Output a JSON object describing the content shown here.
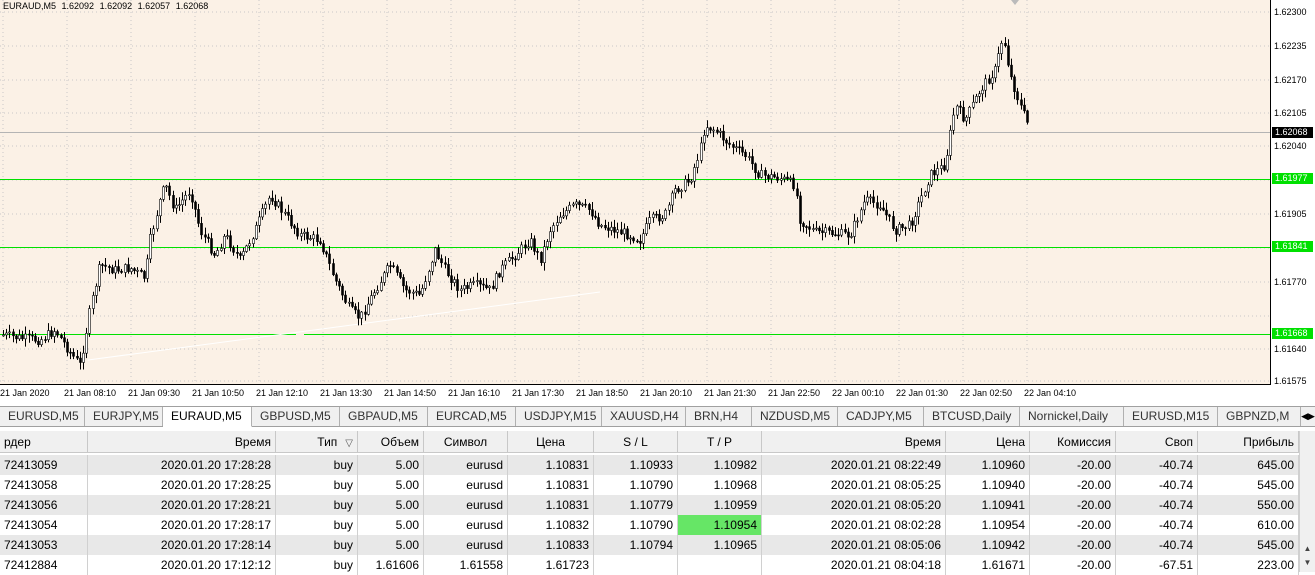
{
  "chart": {
    "symbol": "EURAUD,M5",
    "ohlc": [
      "1.62092",
      "1.62092",
      "1.62057",
      "1.62068"
    ],
    "background": "#fbf1e6",
    "level_color": "#00e000",
    "price_axis": [
      "1.62300",
      "1.62235",
      "1.62170",
      "1.62105",
      "1.62040",
      "1.61905",
      "1.61770",
      "1.61640",
      "1.61575"
    ],
    "current_price": "1.62068",
    "levels": [
      "1.61977",
      "1.61841",
      "1.61668"
    ],
    "time_axis": [
      "21 Jan 2020",
      "21 Jan 08:10",
      "21 Jan 09:30",
      "21 Jan 10:50",
      "21 Jan 12:10",
      "21 Jan 13:30",
      "21 Jan 14:50",
      "21 Jan 16:10",
      "21 Jan 17:30",
      "21 Jan 18:50",
      "21 Jan 20:10",
      "21 Jan 21:30",
      "21 Jan 22:50",
      "22 Jan 00:10",
      "22 Jan 01:30",
      "22 Jan 02:50",
      "22 Jan 04:10"
    ]
  },
  "tabs": [
    "EURUSD,M5",
    "EURJPY,M5",
    "EURAUD,M5",
    "GBPUSD,M5",
    "GBPAUD,M5",
    "EURCAD,M5",
    "USDJPY,M15",
    "XAUUSD,H4",
    "BRN,H4",
    "NZDUSD,M5",
    "CADJPY,M5",
    "BTCUSD,Daily",
    "Nornickel,Daily",
    "EURUSD,M15",
    "GBPNZD,M"
  ],
  "active_tab": "EURAUD,M5",
  "orders": {
    "columns": [
      "рдер",
      "Время",
      "Тип",
      "Объем",
      "Символ",
      "Цена",
      "S / L",
      "T / P",
      "Время",
      "Цена",
      "Комиссия",
      "Своп",
      "Прибыль"
    ],
    "sort_indicator": "▽",
    "highlight_color": "#66e666",
    "rows": [
      [
        "72413059",
        "2020.01.20 17:28:28",
        "buy",
        "5.00",
        "eurusd",
        "1.10831",
        "1.10933",
        "1.10982",
        "2020.01.21 08:22:49",
        "1.10960",
        "-20.00",
        "-40.74",
        "645.00"
      ],
      [
        "72413058",
        "2020.01.20 17:28:25",
        "buy",
        "5.00",
        "eurusd",
        "1.10831",
        "1.10790",
        "1.10968",
        "2020.01.21 08:05:25",
        "1.10940",
        "-20.00",
        "-40.74",
        "545.00"
      ],
      [
        "72413056",
        "2020.01.20 17:28:21",
        "buy",
        "5.00",
        "eurusd",
        "1.10831",
        "1.10779",
        "1.10959",
        "2020.01.21 08:05:20",
        "1.10941",
        "-20.00",
        "-40.74",
        "550.00"
      ],
      [
        "72413054",
        "2020.01.20 17:28:17",
        "buy",
        "5.00",
        "eurusd",
        "1.10832",
        "1.10790",
        "1.10954",
        "2020.01.21 08:02:28",
        "1.10954",
        "-20.00",
        "-40.74",
        "610.00"
      ],
      [
        "72413053",
        "2020.01.20 17:28:14",
        "buy",
        "5.00",
        "eurusd",
        "1.10833",
        "1.10794",
        "1.10965",
        "2020.01.21 08:05:06",
        "1.10942",
        "-20.00",
        "-40.74",
        "545.00"
      ],
      [
        "72412884",
        "2020.01.20 17:12:12",
        "buy",
        "1.61606",
        "1.61558",
        "1.61723",
        "",
        "",
        "2020.01.21 08:04:18",
        "1.61671",
        "-20.00",
        "-67.51",
        "223.00"
      ]
    ]
  }
}
